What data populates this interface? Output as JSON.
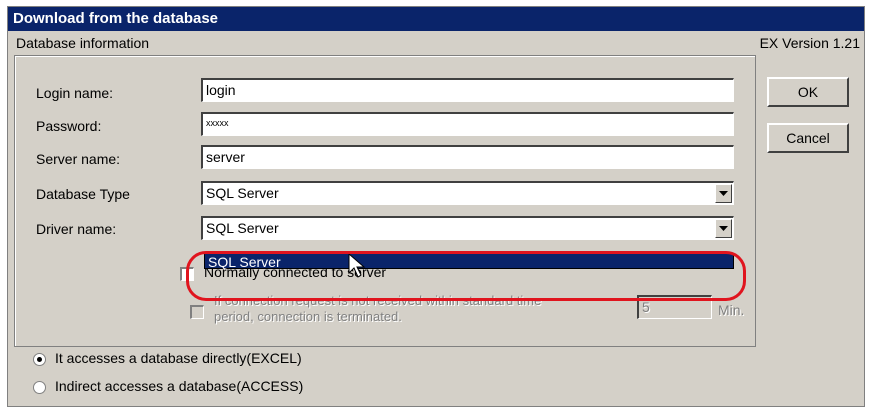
{
  "dialog": {
    "title": "Download from the database",
    "version": "EX Version 1.21",
    "group_label": "Database information"
  },
  "fields": {
    "login_label": "Login name:",
    "login_value": "login",
    "password_label": "Password:",
    "password_value": "xxxxx",
    "server_label": "Server name:",
    "server_value": "server",
    "dbtype_label": "Database Type",
    "dbtype_value": "SQL Server",
    "driver_label": "Driver name:",
    "driver_value": "SQL Server",
    "driver_dropdown_option": "SQL Server"
  },
  "options": {
    "normally_connected_label": "Normally connected to server",
    "terminate_line1": "If connection request is not received within standard time",
    "terminate_line2": "period, connection is terminated.",
    "minutes_value": "5",
    "minutes_unit": "Min."
  },
  "access": {
    "direct_label": "It accesses a database directly(EXCEL)",
    "indirect_label": "Indirect accesses a database(ACCESS)",
    "selected": "direct"
  },
  "buttons": {
    "ok": "OK",
    "cancel": "Cancel"
  },
  "colors": {
    "titlebar": "#0a246a",
    "face": "#d4d0c8",
    "highlight_annotation": "#e0141e"
  }
}
